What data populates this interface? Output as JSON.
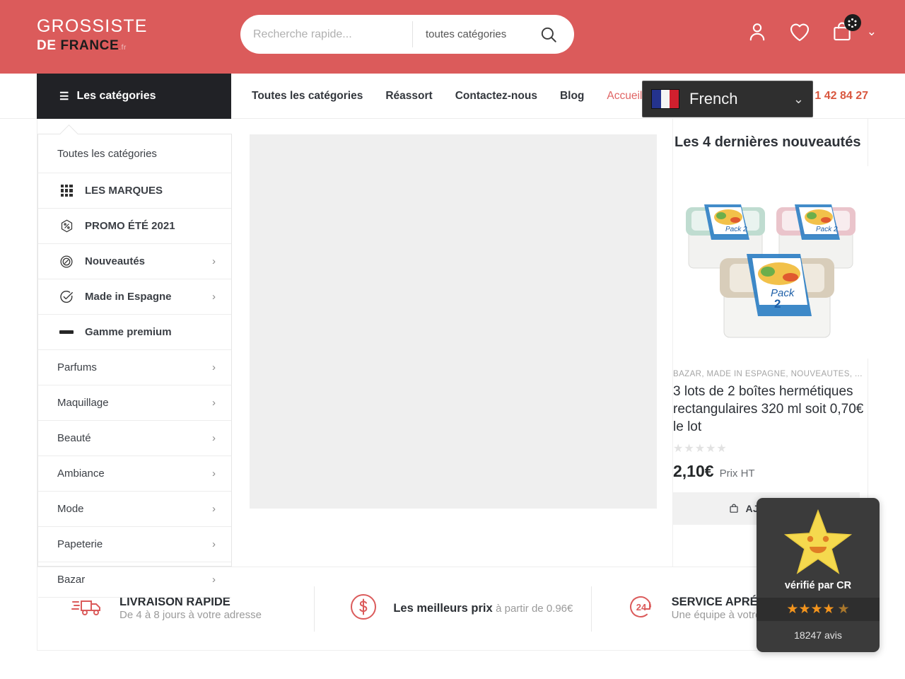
{
  "header": {
    "logo": {
      "line1": "GROSSISTE",
      "de": "DE ",
      "france": "FRANCE",
      "domain": ".fr"
    },
    "search": {
      "placeholder": "Recherche rapide...",
      "value": "",
      "category_value": "toutes catégories",
      "search_icon": "search-icon"
    },
    "icons": {
      "account": "user-icon",
      "wishlist": "heart-icon",
      "cart": "shopping-bag-icon",
      "cart_badge": "loading-dots",
      "chevron": "chevron-down-icon"
    },
    "colors": {
      "header_bg": "#db5b5b",
      "nav_dark": "#212226",
      "accent": "#d9573f"
    }
  },
  "nav": {
    "categories_button": "Les catégories",
    "links": [
      {
        "label": "Toutes les catégories",
        "active": false
      },
      {
        "label": "Réassort",
        "active": false
      },
      {
        "label": "Contactez-nous",
        "active": false
      },
      {
        "label": "Blog",
        "active": false
      },
      {
        "label": "Accueil",
        "active": true
      }
    ],
    "phone": "1 42 84 27",
    "language": {
      "label": "French",
      "flag": "france-flag-icon",
      "chevron": "chevron-down-icon"
    }
  },
  "sidebar": {
    "heading": "Toutes les catégories",
    "items": [
      {
        "label": "LES MARQUES",
        "icon": "grid-dots-icon",
        "arrow": false,
        "bold": true
      },
      {
        "label": "PROMO ÉTÉ 2021",
        "icon": "percent-badge-icon",
        "arrow": false,
        "bold": true
      },
      {
        "label": "Nouveautés",
        "icon": "tag-icon",
        "arrow": true,
        "bold": true
      },
      {
        "label": "Made in Espagne",
        "icon": "check-circle-icon",
        "arrow": true,
        "bold": true
      },
      {
        "label": "Gamme premium",
        "icon": "dash-icon",
        "arrow": false,
        "bold": true
      },
      {
        "label": "Parfums",
        "icon": "",
        "arrow": true,
        "bold": false
      },
      {
        "label": "Maquillage",
        "icon": "",
        "arrow": true,
        "bold": false
      },
      {
        "label": "Beauté",
        "icon": "",
        "arrow": true,
        "bold": false
      },
      {
        "label": "Ambiance",
        "icon": "",
        "arrow": true,
        "bold": false
      },
      {
        "label": "Mode",
        "icon": "",
        "arrow": true,
        "bold": false
      },
      {
        "label": "Papeterie",
        "icon": "",
        "arrow": true,
        "bold": false
      },
      {
        "label": "Bazar",
        "icon": "",
        "arrow": true,
        "bold": false
      }
    ]
  },
  "products_panel": {
    "title": "Les 4 dernières nouveautés",
    "product": {
      "categories": "BAZAR, MADE IN ESPAGNE, NOUVEAUTÉS, ...",
      "name": "3 lots de 2 boîtes hermétiques rectangulaires 320 ml soit 0,70€ le lot",
      "rating_stars": "★★★★★",
      "rating_value": 0,
      "price": "2,10€",
      "price_note": "Prix HT",
      "add_to_cart": "AJOUTER A",
      "cart_icon": "shopping-bag-icon",
      "image_alt": "pack-2-food-containers"
    }
  },
  "features": [
    {
      "icon": "delivery-truck-icon",
      "title": "LIVRAISON RAPIDE",
      "subtitle": "De 4 à 8 jours à votre adresse"
    },
    {
      "icon": "dollar-circle-icon",
      "title": "Les meilleurs prix",
      "subtitle": "à partir de 0.96€"
    },
    {
      "icon": "24h-support-icon",
      "title": "SERVICE APRÉS VENTE",
      "subtitle": "Une équipe à votre service"
    }
  ],
  "review_widget": {
    "big_star": "smiling-star-icon",
    "label": "vérifié par CR",
    "stars": "★★★★",
    "half_star": "★",
    "count": "18247 avis"
  }
}
